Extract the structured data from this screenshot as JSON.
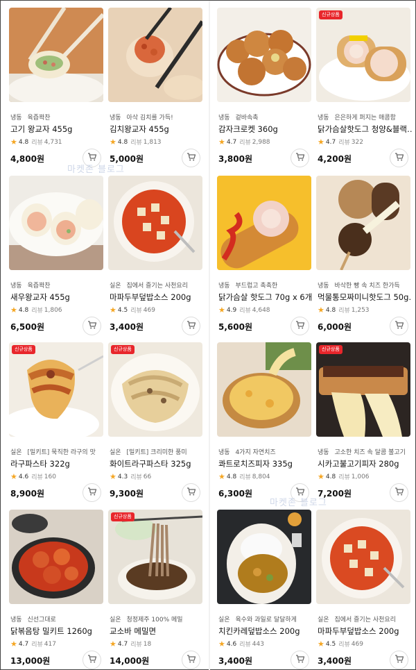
{
  "colors": {
    "badge": "#e8262b",
    "star": "#f5a623",
    "price": "#111111",
    "watermark": "#c9d3e6"
  },
  "watermarks": [
    "마켓존 블로그",
    "마켓존 블로그"
  ],
  "products": [
    {
      "kind": "냉동",
      "tag": "육즙꽉찬",
      "name": "고기 왕교자 455g",
      "score": "4.8",
      "review_label": "리뷰",
      "reviews": "4,731",
      "price": "4,800원",
      "badge": "",
      "image": "dumpling-chopsticks"
    },
    {
      "kind": "냉동",
      "tag": "아삭 김치를 가득!",
      "name": "김치왕교자 455g",
      "score": "4.8",
      "review_label": "리뷰",
      "reviews": "1,813",
      "price": "5,000원",
      "badge": "",
      "image": "kimchi-dumpling-chopsticks"
    },
    {
      "kind": "냉동",
      "tag": "겉바속촉",
      "name": "감자크로켓 360g",
      "score": "4.7",
      "review_label": "리뷰",
      "reviews": "2,988",
      "price": "3,800원",
      "badge": "",
      "image": "croquettes"
    },
    {
      "kind": "냉동",
      "tag": "은은하게 퍼지는 매콤함",
      "name": "닭가슴살핫도그 청양&블랙…",
      "score": "4.7",
      "review_label": "리뷰",
      "reviews": "322",
      "price": "4,200원",
      "badge": "신규상품",
      "image": "hotdog-plate"
    },
    {
      "kind": "냉동",
      "tag": "육즙꽉찬",
      "name": "새우왕교자 455g",
      "score": "4.8",
      "review_label": "리뷰",
      "reviews": "1,806",
      "price": "6,500원",
      "badge": "",
      "image": "shrimp-dumplings"
    },
    {
      "kind": "실온",
      "tag": "집에서 즐기는 사천요리",
      "name": "마파두부덮밥소스 200g",
      "score": "4.5",
      "review_label": "리뷰",
      "reviews": "469",
      "price": "3,400원",
      "badge": "",
      "image": "mapo-tofu-bowl"
    },
    {
      "kind": "냉동",
      "tag": "부드럽고 촉촉한",
      "name": "닭가슴살 핫도그 70g x 6개입",
      "score": "4.9",
      "review_label": "리뷰",
      "reviews": "4,648",
      "price": "5,600원",
      "badge": "",
      "image": "hotdog-ketchup"
    },
    {
      "kind": "냉동",
      "tag": "바삭한 빵 속 치즈 한가득",
      "name": "먹물통모짜미니핫도그 50g…",
      "score": "4.8",
      "review_label": "리뷰",
      "reviews": "1,253",
      "price": "6,000원",
      "badge": "",
      "image": "black-cheese-hotdog"
    },
    {
      "kind": "실온",
      "tag": "[밀키트] 묵직한 라구의 맛",
      "name": "라구파스타 322g",
      "score": "4.6",
      "review_label": "리뷰",
      "reviews": "160",
      "price": "8,900원",
      "badge": "신규상품",
      "image": "ragu-pasta"
    },
    {
      "kind": "실온",
      "tag": "[밀키트] 크리미한 풍미",
      "name": "화이트라구파스타 325g",
      "score": "4.3",
      "review_label": "리뷰",
      "reviews": "66",
      "price": "9,300원",
      "badge": "신규상품",
      "image": "white-ragu-pasta"
    },
    {
      "kind": "냉동",
      "tag": "4가지 자연치즈",
      "name": "콰트로치즈피자 335g",
      "score": "4.8",
      "review_label": "리뷰",
      "reviews": "8,804",
      "price": "6,300원",
      "badge": "",
      "image": "cheese-pizza"
    },
    {
      "kind": "냉동",
      "tag": "고소한 치즈 속 달콤 불고기",
      "name": "시카고불고기피자 280g",
      "score": "4.8",
      "review_label": "리뷰",
      "reviews": "1,006",
      "price": "7,200원",
      "badge": "신규상품",
      "image": "bulgogi-pizza"
    },
    {
      "kind": "냉동",
      "tag": "신선그대로",
      "name": "닭볶음탕 밀키트 1260g",
      "score": "4.7",
      "review_label": "리뷰",
      "reviews": "417",
      "price": "13,000원",
      "badge": "",
      "image": "spicy-chicken-pan"
    },
    {
      "kind": "실온",
      "tag": "청정제주 100% 메밀",
      "name": "교소바 메밀면",
      "score": "4.7",
      "review_label": "리뷰",
      "reviews": "18",
      "price": "14,000원",
      "badge": "신규상품",
      "image": "soba-noodles"
    },
    {
      "kind": "실온",
      "tag": "육수와 과일로 달달하게",
      "name": "치킨카레덮밥소스 200g",
      "score": "4.6",
      "review_label": "리뷰",
      "reviews": "443",
      "price": "3,400원",
      "badge": "",
      "image": "chicken-curry"
    },
    {
      "kind": "실온",
      "tag": "집에서 즐기는 사천요리",
      "name": "마파두부덮밥소스 200g",
      "score": "4.5",
      "review_label": "리뷰",
      "reviews": "469",
      "price": "3,400원",
      "badge": "",
      "image": "mapo-tofu-bowl-2"
    }
  ]
}
